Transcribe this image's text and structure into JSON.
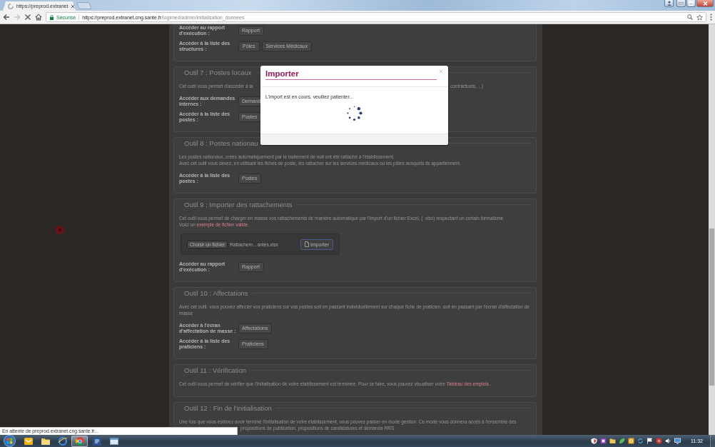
{
  "browser": {
    "tab": {
      "title": "https://preprod.extranet"
    },
    "nav": [
      {
        "kind": "back",
        "disabled": false
      },
      {
        "kind": "forward",
        "disabled": true
      },
      {
        "kind": "stop",
        "disabled": false
      },
      {
        "kind": "home",
        "disabled": false
      }
    ],
    "address_bar": {
      "security_label": "Sécurisé",
      "host": "https://preprod.extranet.cng.sante.fr",
      "path": "/logimed/admin/initialisation_donnees"
    }
  },
  "sections": [
    {
      "rows": [
        {
          "label": "Accéder au rapport d'exécution :",
          "buttons": [
            "Rapport"
          ]
        },
        {
          "label": "Accéder à la liste des structures :",
          "buttons": [
            "Pôles",
            "Services Médicaux"
          ]
        }
      ]
    },
    {
      "title": "Outil 7 : Postes locaux",
      "lines": [
        {
          "kind": "split",
          "parts": [
            {
              "kind": "text",
              "text": "Cet outil vous permet d'accéder à la"
            },
            {
              "kind": "text",
              "text": "contractuels, ...)"
            }
          ]
        }
      ],
      "rows": [
        {
          "label": "Accéder aux demandes internes :",
          "buttons": [
            "Demand"
          ]
        },
        {
          "label": "Accéder à la liste des postes :",
          "buttons": [
            "Postes"
          ]
        }
      ]
    },
    {
      "title": "Outil 8 : Postes nationau",
      "lines": [
        {
          "kind": "flow",
          "parts": [
            {
              "kind": "text",
              "text": "Les postes nationaux, créés automatiquement par le traitement de nuit ont été rattaché à l'établissement."
            }
          ]
        },
        {
          "kind": "flow",
          "parts": [
            {
              "kind": "text",
              "text": "Avec cet outil vous devez, en utilisant les fiches de poste, les rattacher sur les services médicaux ou les pôles auxquels ils appartiennent."
            }
          ]
        }
      ],
      "rows": [
        {
          "label": "Accéder à la liste des postes :",
          "buttons": [
            "Postes"
          ]
        }
      ]
    },
    {
      "title": "Outil 9 : Importer des rattachements",
      "lines": [
        {
          "kind": "flow",
          "parts": [
            {
              "kind": "text",
              "text": "Cet outil vous permet de charger en masse vos rattachements de manière automatique par l'import d'un fichier Excel, ( .xlsx) respectant un certain formalisme."
            }
          ]
        },
        {
          "kind": "flow",
          "parts": [
            {
              "kind": "text",
              "text": "Voici un "
            },
            {
              "kind": "link",
              "text": "exemple de fichier valide"
            },
            {
              "kind": "text",
              "text": "."
            }
          ]
        }
      ],
      "upload": {
        "choose_button": "Choisir un fichier",
        "file_name": "Rattachem…antes.xlsx",
        "import_button": "Importer"
      },
      "rows": [
        {
          "label": "Accéder au rapport d'exécution :",
          "buttons": [
            "Rapport"
          ]
        }
      ]
    },
    {
      "title": "Outil 10 : Affectations",
      "lines": [
        {
          "kind": "flow",
          "parts": [
            {
              "kind": "text",
              "text": "Avec cet outil, vous pouvez affecter vos praticiens sur vos postes soit en passant individuellement sur chaque fiche de praticien, soit en passant par l'écran d'affectation de masse"
            }
          ]
        }
      ],
      "rows": [
        {
          "label": "Accéder à l'écran d'affectation de masse :",
          "buttons": [
            "Affectations"
          ]
        },
        {
          "label": "Accéder à la liste des praticiens :",
          "buttons": [
            "Praticiens"
          ]
        }
      ]
    },
    {
      "title": "Outil 11 : Vérification",
      "lines": [
        {
          "kind": "flow",
          "parts": [
            {
              "kind": "text",
              "text": "Cet outil vous permet de vérifier que l'initialisation de votre établissement est terminée. Pour ce faire, vous pouvez visualiser votre "
            },
            {
              "kind": "link",
              "text": "Tableau des emplois"
            },
            {
              "kind": "text",
              "text": " ."
            }
          ]
        }
      ]
    },
    {
      "title": "Outil 12 : Fin de l'initialisation",
      "lines": [
        {
          "kind": "flow",
          "parts": [
            {
              "kind": "text",
              "text": "Une fois que vous estimez avoir terminé l'initialisation de votre établissement, vous pouvez passer en mode gestion. Ce mode vous donnera accès à l'ensemble des"
            }
          ]
        },
        {
          "kind": "tail",
          "parts": [
            {
              "kind": "text",
              "text": "propositions de publication, propositions de candidatures et demande RRS"
            }
          ]
        }
      ]
    }
  ],
  "dialog": {
    "title": "Importer",
    "message": "L'import est en cours, veuillez patienter..."
  },
  "status_bubble": "En attente de preprod.extranet.cng.sante.fr...",
  "taskbar": {
    "apps": [
      {
        "kind": "mail",
        "active": false
      },
      {
        "kind": "folder",
        "active": false
      },
      {
        "kind": "globe",
        "active": false
      },
      {
        "kind": "browser",
        "active": true
      },
      {
        "kind": "document",
        "active": false
      },
      {
        "kind": "window",
        "active": false
      }
    ],
    "tray": [
      {
        "kind": "shield"
      },
      {
        "kind": "note"
      },
      {
        "kind": "folder"
      },
      {
        "kind": "leaf"
      },
      {
        "kind": "mail"
      },
      {
        "kind": "sync"
      },
      {
        "kind": "flag"
      },
      {
        "kind": "alert"
      },
      {
        "kind": "speaker"
      },
      {
        "kind": "monitor"
      }
    ],
    "clock": "11:32"
  }
}
